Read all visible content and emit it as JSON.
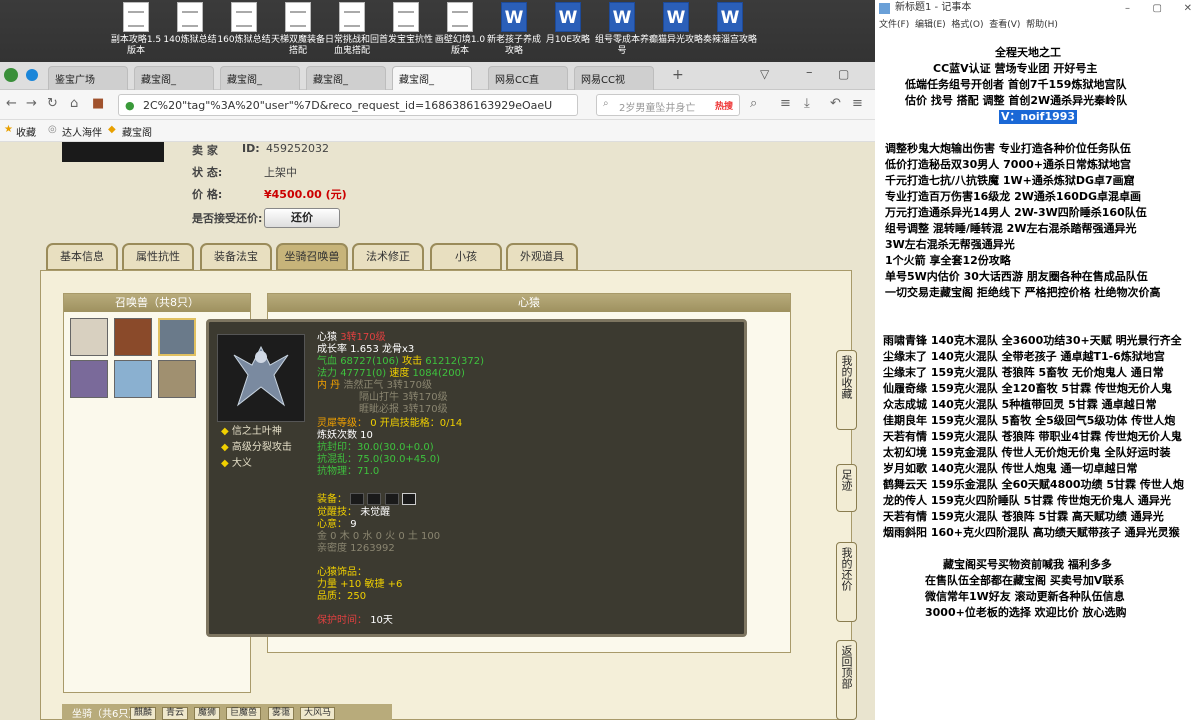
{
  "desktop": {
    "icons": [
      {
        "label": "副本攻略1.5版本",
        "type": "doc"
      },
      {
        "label": "140炼狱总结",
        "type": "doc"
      },
      {
        "label": "160炼狱总结",
        "type": "doc"
      },
      {
        "label": "天梯双魔装备搭配",
        "type": "doc"
      },
      {
        "label": "日常挑战和回血鬼搭配",
        "type": "doc"
      },
      {
        "label": "首发宝宝抗性",
        "type": "doc"
      },
      {
        "label": "画壁幻境1.0版本",
        "type": "doc"
      },
      {
        "label": "新老孩子养成攻略",
        "type": "word"
      },
      {
        "label": "月10E攻略",
        "type": "word"
      },
      {
        "label": "组号零成本养号",
        "type": "word"
      },
      {
        "label": "癫猫异光攻略",
        "type": "word"
      },
      {
        "label": "奏辣淄宫攻略",
        "type": "word"
      }
    ]
  },
  "browser": {
    "tabs": [
      {
        "label": "鉴宝广场"
      },
      {
        "label": "藏宝阁_"
      },
      {
        "label": "藏宝阁_"
      },
      {
        "label": "藏宝阁_"
      },
      {
        "label": "藏宝阁_",
        "active": true
      },
      {
        "label": "网易CC直"
      },
      {
        "label": "网易CC视"
      }
    ],
    "url": "2C%20\"tag\"%3A%20\"user\"%7D&reco_request_id=1686386163929eOaeU",
    "search_placeholder": "2岁男童坠井身亡",
    "hot_label": "热搜",
    "favorites": [
      "收藏",
      "达人海伴",
      "藏宝阁"
    ]
  },
  "listing": {
    "seller_label": "卖  家",
    "seller_id_label": "ID:",
    "seller_id": "459252032",
    "status_label": "状      态:",
    "status": "上架中",
    "price_label": "价      格:",
    "price": "¥4500.00 (元)",
    "haggle_label": "是否接受还价:",
    "haggle_button": "还价"
  },
  "tabs": [
    {
      "label": "基本信息"
    },
    {
      "label": "属性抗性"
    },
    {
      "label": "装备法宝"
    },
    {
      "label": "坐骑召唤兽",
      "active": true
    },
    {
      "label": "法术修正"
    },
    {
      "label": "小孩"
    },
    {
      "label": "外观道具"
    }
  ],
  "summons_panel": {
    "header": "召唤兽（共8只）"
  },
  "detail_panel": {
    "header": "心猿"
  },
  "tooltip": {
    "name": "心猿",
    "tier": "3转170级",
    "growth": "成长率 1.653 龙骨x3",
    "hp_label": "气血",
    "hp": "68727(106)",
    "atk_label": "攻击",
    "atk": "61212(372)",
    "mp_label": "法力",
    "mp": "47771(0)",
    "speed_label": "速度",
    "speed": "1084(200)",
    "core_label": "内    丹",
    "cores": [
      {
        "name": "浩然正气",
        "level": "3转170级"
      },
      {
        "name": "隔山打牛",
        "level": "3转170级"
      },
      {
        "name": "睚眦必报",
        "level": "3转170级"
      }
    ],
    "soul_label": "灵犀等级：",
    "soul_value": "0 开启技能格：0/14",
    "refine": "炼妖次数 10",
    "resist_seal": "抗封印：30.0(30.0+0.0)",
    "resist_magic": "抗混乱：75.0(30.0+45.0)",
    "resist_phys": "抗物理：71.0",
    "skills": [
      {
        "name": "信之土叶神"
      },
      {
        "name": "高级分裂攻击"
      },
      {
        "name": "大义"
      }
    ],
    "equip_label": "装备：",
    "awaken_label": "觉醒技：",
    "awaken": "未觉醒",
    "heart_label": "心意：",
    "heart": "9",
    "elements": "金 0 木 0 水 0 火 0 土 100",
    "intimacy": "亲密度 1263992",
    "accessory_label": "心猿饰品：",
    "accessory_stats": "力量 +10 敏捷 +6",
    "quality": "品质：250",
    "protect_label": "保护时间：",
    "protect": "10天"
  },
  "side_buttons": [
    {
      "label": "我的收藏"
    },
    {
      "label": "足迹"
    },
    {
      "label": "我的还价"
    },
    {
      "label": "返回顶部"
    }
  ],
  "mount_bar": {
    "label": "坐骑（共6只）",
    "items": [
      "麒麟",
      "青云",
      "魔狮",
      "巨魔兽",
      "雾霭",
      "大风马"
    ]
  },
  "notepad": {
    "title": "新标题1 - 记事本",
    "menu": [
      "文件(F)",
      "编辑(E)",
      "格式(O)",
      "查看(V)",
      "帮助(H)"
    ],
    "lines": [
      {
        "text": "全程天地之工"
      },
      {
        "text": "CC蓝V认证 营场专业团 开好号主"
      },
      {
        "text": "低端任务组号开创者          首创7千159炼狱地宫队"
      },
      {
        "text": "估价 找号 搭配 调整          首创2W通杀异光秦岭队"
      },
      {
        "text": "V：noif1993",
        "highlight": true
      },
      {
        "text": "调整秒鬼大炮输出伤害          专业打造各种价位任务队伍"
      },
      {
        "text": "低价打造秘岳双30男人            7000+通杀日常炼狱地宫"
      },
      {
        "text": "千元打造七抗/八抗铁魔          1W+通杀炼狱DG卓7画窟"
      },
      {
        "text": "专业打造百万伤害16级龙          2W通杀160DG卓混卓画"
      },
      {
        "text": "万元打造通杀异光14男人        2W-3W四阶睡杀160队伍"
      },
      {
        "text": "组号调整 混转睡/睡转混          2W左右混杀踏帮强通异光"
      },
      {
        "text": "                                                3W左右混杀无帮强通异光"
      },
      {
        "text": "1个火箭 享全套12份攻略"
      },
      {
        "text": "单号5W内估价 30大话西游          朋友圈各种在售成品队伍"
      },
      {
        "text": "一切交易走藏宝阁 拒绝线下      严格把控价格 杜绝物次价高"
      },
      {
        "text": "雨啸青锋 140克木混队 全3600功结30+天赋 明光景行齐全"
      },
      {
        "text": "尘缘末了 140克火混队 全带老孩子 通卓越T1-6炼狱地宫"
      },
      {
        "text": "尘缘末了 159克火混队 苍狼阵 5畜牧 无价炮鬼人 通日常"
      },
      {
        "text": "仙履奇缘 159克火混队 全120畜牧 5甘霖 传世炮无价人鬼"
      },
      {
        "text": "众志成城 140克火混队 5种植带回灵 5甘霖 通卓越日常"
      },
      {
        "text": "佳期良年 159克火混队 5畜牧 全5级回气5级功体 传世人炮"
      },
      {
        "text": "天若有情 159克火混队 苍狼阵 带职业4甘霖 传世炮无价人鬼"
      },
      {
        "text": "太初幻境 159克金混队 传世人无价炮无价鬼 全队好运时装"
      },
      {
        "text": "岁月如歌 140克火混队 传世人炮鬼 通一切卓越日常"
      },
      {
        "text": "鹤舞云天 159乐金混队 全60天赋4800功绩 5甘霖 传世人炮"
      },
      {
        "text": "龙的传人 159克火四阶睡队 5甘霖 传世炮无价鬼人 通异光"
      },
      {
        "text": "天若有情 159克火混队 苍狼阵 5甘霖 高天赋功绩 通异光"
      },
      {
        "text": "烟雨斜阳 160+克火四阶混队 高功绩天赋带孩子 通异光灵猴"
      },
      {
        "text": "藏宝阁买号买物资前喊我 福利多多"
      },
      {
        "text": "在售队伍全部都在藏宝阁 买卖号加V联系"
      },
      {
        "text": "微信常年1W好友 滚动更新各种队伍信息"
      },
      {
        "text": "3000+位老板的选择 欢迎比价 放心选购"
      }
    ]
  }
}
